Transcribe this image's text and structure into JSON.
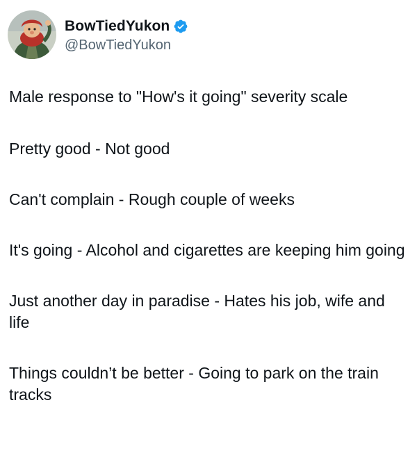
{
  "author": {
    "display_name": "BowTiedYukon",
    "handle": "@BowTiedYukon",
    "verified": true,
    "avatar_icon": "red-bearded-character-avatar",
    "colors": {
      "verified_badge": "#1d9bf0",
      "handle": "#536471",
      "text": "#0f1419"
    }
  },
  "tweet": {
    "title": "Male response to \"How's it going\" severity scale",
    "lines": [
      "Pretty good - Not good",
      "Can't complain - Rough couple of weeks",
      "It's going - Alcohol and cigarettes are keeping him going",
      "Just another day in paradise - Hates his job, wife and life",
      "Things couldn’t be better - Going to park on the train tracks"
    ]
  }
}
